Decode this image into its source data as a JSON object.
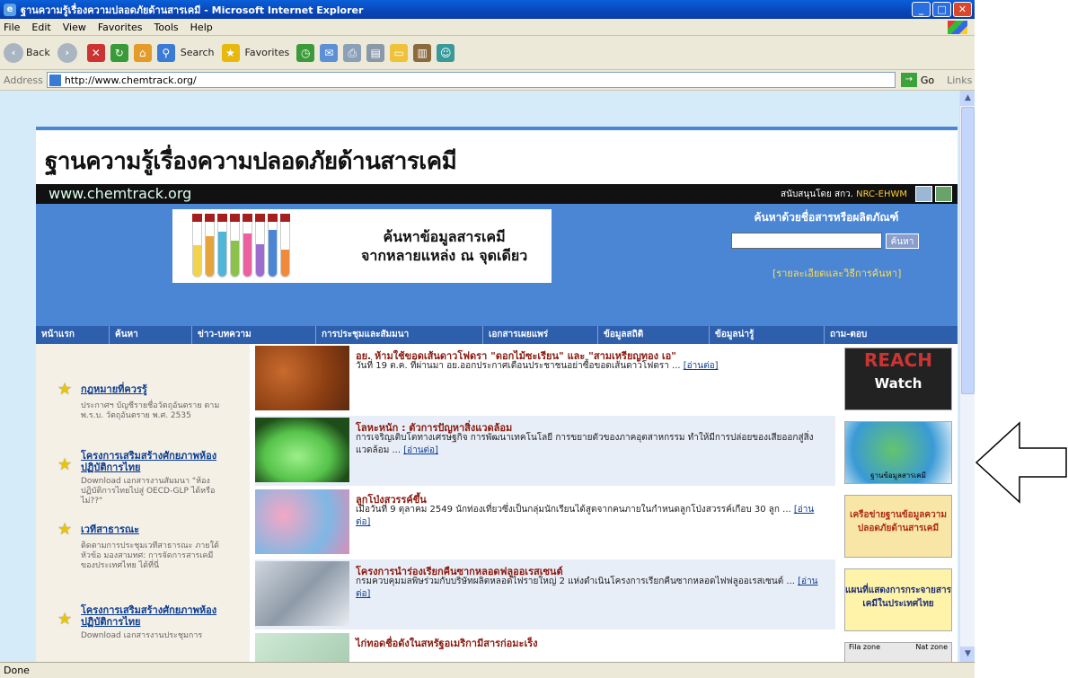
{
  "window": {
    "title": "ฐานความรู้เรื่องความปลอดภัยด้านสารเคมี - Microsoft Internet Explorer",
    "minimize": "_",
    "maximize": "□",
    "close": "✕"
  },
  "menu": [
    "File",
    "Edit",
    "View",
    "Favorites",
    "Tools",
    "Help"
  ],
  "toolbar": {
    "back": "Back",
    "search": "Search",
    "favorites": "Favorites"
  },
  "address": {
    "label": "Address",
    "url": "http://www.chemtrack.org/",
    "go": "Go",
    "links": "Links"
  },
  "status": {
    "text": "Done"
  },
  "site": {
    "title": "ฐานความรู้เรื่องความปลอดภัยด้านสารเคมี",
    "domain": "www.chemtrack.org",
    "support_prefix": "สนับสนุนโดย สกว.",
    "support_org": "NRC-EHWM",
    "ad_line1": "ค้นหาข้อมูลสารเคมี",
    "ad_line2": "จากหลายแหล่ง ณ จุดเดียว",
    "search_title": "ค้นหาด้วยชื่อสารหรือผลิตภัณฑ์",
    "search_button": "ค้นหา",
    "search_hint": "[รายละเอียดและวิธีการค้นหา]"
  },
  "nav": [
    "หน้าแรก",
    "ค้นหา",
    "ข่าว-บทความ",
    "การประชุมและสัมมนา",
    "เอกสารเผยแพร่",
    "ข้อมูลสถิติ",
    "ข้อมูลน่ารู้",
    "ถาม-ตอบ"
  ],
  "left": [
    {
      "title": "กฎหมายที่ควรรู้",
      "desc": "ประกาศฯ บัญชีรายชื่อวัตถุอันตราย ตาม พ.ร.บ. วัตถุอันตราย พ.ศ. 2535"
    },
    {
      "title": "โครงการเสริมสร้างศักยภาพห้องปฏิบัติการไทย",
      "desc": "Download เอกสารงานสัมมนา \"ห้องปฏิบัติการไทยไปสู่ OECD-GLP ได้หรือไม่??\""
    },
    {
      "title": "เวทีสาธารณะ",
      "desc": "ติดตามการประชุมเวทีสาธารณะ ภายใต้หัวข้อ มองสามทศ: การจัดการสารเคมีของประเทศไทย ได้ที่นี่"
    },
    {
      "title": "โครงการเสริมสร้างศักยภาพห้องปฏิบัติการไทย",
      "desc": "Download เอกสารงานประชุมการ"
    }
  ],
  "news": [
    {
      "title": "อย. ห้ามใช้ขอดเส้นดาวโฟดรา \"ดอกไม้ซะเรียน\" และ \"สามเหรียญทอง เอ\"",
      "desc": "วันที่ 19 ต.ค. ที่ผ่านมา อย.ออกประกาศเตือนประชาชนอย่าซื้อขอดเส้นดาวโฟดรา ...",
      "more": "[อ่านต่อ]"
    },
    {
      "title": "โลหะหนัก : ตัวการปัญหาสิ่งแวดล้อม",
      "desc": "การเจริญเติบโตทางเศรษฐกิจ การพัฒนาเทคโนโลยี การขยายตัวของภาคอุตสาหกรรม ทำให้มีการปล่อยของเสียออกสู่สิ่งแวดล้อม ...",
      "more": "[อ่านต่อ]"
    },
    {
      "title": "ลูกโป่งสวรรค์ขึ้น",
      "desc": "เมื่อวันที่ 9 ตุลาคม 2549 นักท่องเที่ยวซึ่งเป็นกลุ่มนักเรียนได้สูดจากคนภายในกำหนดลูกโป่งสวรรค์เกือบ 30 ลูก ...",
      "more": "[อ่านต่อ]"
    },
    {
      "title": "โครงการนำร่องเรียกคืนซากหลอดฟลูออเรสเซนต์",
      "desc": "กรมควบคุมมลพิษร่วมกับบริษัทผลิตหลอดไฟรายใหญ่ 2 แห่งดำเนินโครงการเรียกคืนซากหลอดไฟฟลูออเรสเซนต์ ...",
      "more": "[อ่านต่อ]"
    },
    {
      "title": "ไก่ทอดชื่อดังในสหรัฐอเมริกามีสารก่อมะเร็ง",
      "desc": "",
      "more": ""
    }
  ],
  "right": {
    "reach_top": "REACH",
    "reach_bottom": "Watch",
    "map_label": "ฐานข้อมูลสารเคมี",
    "network": "เครือข่ายฐานข้อมูลความปลอดภัยด้านสารเคมี",
    "map_thai": "แผนที่แสดงการกระจายสารเคมีในประเทศไทย",
    "zone1": "Fila zone",
    "zone2": "Nat zone"
  },
  "colors": {
    "nav": "#2d5fad",
    "banner": "#4a86d4",
    "page_bg": "#d6ebfa"
  }
}
